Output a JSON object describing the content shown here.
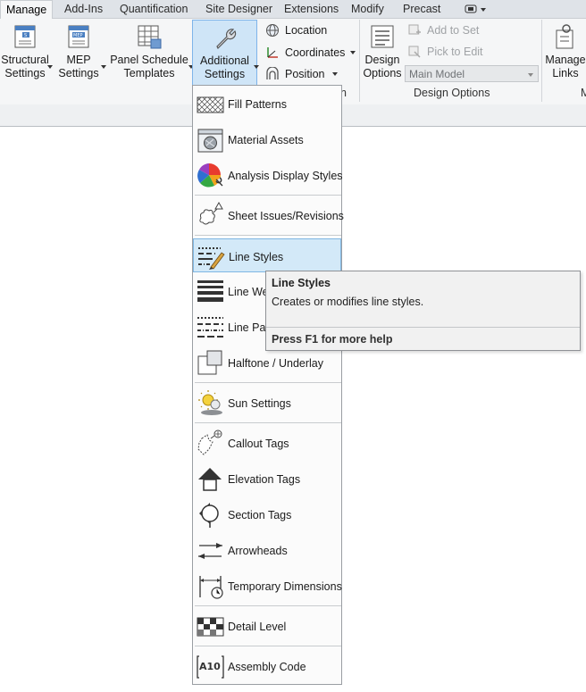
{
  "tabs": [
    "Manage",
    "Add-Ins",
    "Quantification",
    "Site Designer",
    "Extensions",
    "Modify",
    "Precast"
  ],
  "ribbon": {
    "structural_settings": {
      "line1": "Structural",
      "line2": "Settings"
    },
    "mep_settings": {
      "line1": "MEP",
      "line2": "Settings"
    },
    "panel_schedule_templates": {
      "line1": "Panel Schedule",
      "line2": "Templates"
    },
    "additional_settings": {
      "line1": "Additional",
      "line2": "Settings"
    },
    "location": "Location",
    "coordinates": "Coordinates",
    "position": "Position",
    "design_options_button": {
      "line1": "Design",
      "line2": "Options"
    },
    "add_to_set": "Add to Set",
    "pick_to_edit": "Pick to Edit",
    "main_model": "Main Model",
    "design_options_panel": "Design Options",
    "manage_links": {
      "line1": "Manage",
      "line2": "Links"
    },
    "truncated_panel_label": "n",
    "truncated_right_label": "M"
  },
  "menu": [
    {
      "label": "Fill Patterns",
      "icon": "fill-patterns-icon"
    },
    {
      "label": "Material Assets",
      "icon": "material-assets-icon"
    },
    {
      "label": "Analysis Display Styles",
      "icon": "analysis-display-styles-icon"
    },
    {
      "label": "Sheet Issues/Revisions",
      "icon": "sheet-issues-icon"
    },
    {
      "label": "Line Styles",
      "icon": "line-styles-icon"
    },
    {
      "label": "Line We",
      "icon": "line-weights-icon"
    },
    {
      "label": "Line Pat",
      "icon": "line-patterns-icon"
    },
    {
      "label": "Halftone / Underlay",
      "icon": "halftone-icon"
    },
    {
      "label": "Sun Settings",
      "icon": "sun-settings-icon"
    },
    {
      "label": "Callout Tags",
      "icon": "callout-tags-icon"
    },
    {
      "label": "Elevation Tags",
      "icon": "elevation-tags-icon"
    },
    {
      "label": "Section Tags",
      "icon": "section-tags-icon"
    },
    {
      "label": "Arrowheads",
      "icon": "arrowheads-icon"
    },
    {
      "label": "Temporary Dimensions",
      "icon": "temporary-dimensions-icon"
    },
    {
      "label": "Detail Level",
      "icon": "detail-level-icon"
    },
    {
      "label": "Assembly Code",
      "icon": "assembly-code-icon"
    }
  ],
  "tooltip": {
    "title": "Line Styles",
    "description": "Creates or modifies line styles.",
    "help": "Press F1 for more help"
  },
  "colors": {
    "highlight": "#d3e9f8",
    "highlight_border": "#7fb7e3",
    "pressed": "#cfe5f7"
  }
}
